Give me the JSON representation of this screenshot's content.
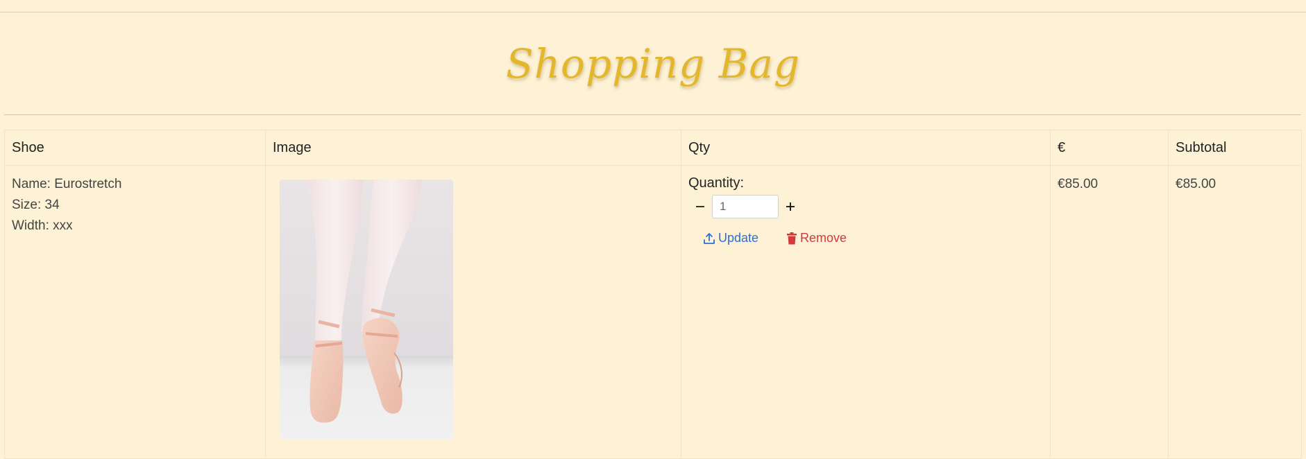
{
  "page": {
    "title": "Shopping Bag"
  },
  "table": {
    "headers": [
      "Shoe",
      "Image",
      "Qty",
      "€",
      "Subtotal"
    ],
    "rows": [
      {
        "name": "Name: Eurostretch",
        "size": "Size: 34",
        "width": "Width: xxx",
        "image_icon": "ballet-pointe-shoes-image",
        "quantity_label": "Quantity:",
        "quantity_value": "1",
        "decrement_icon": "minus-icon",
        "increment_icon": "plus-icon",
        "update_label": "Update",
        "update_icon": "upload-icon",
        "remove_label": "Remove",
        "remove_icon": "trash-icon",
        "price": "€85.00",
        "subtotal": "€85.00"
      }
    ]
  },
  "colors": {
    "background": "#fdf1d6",
    "title": "#e3b72c",
    "update": "#2d6fd6",
    "remove": "#d33a3a"
  }
}
